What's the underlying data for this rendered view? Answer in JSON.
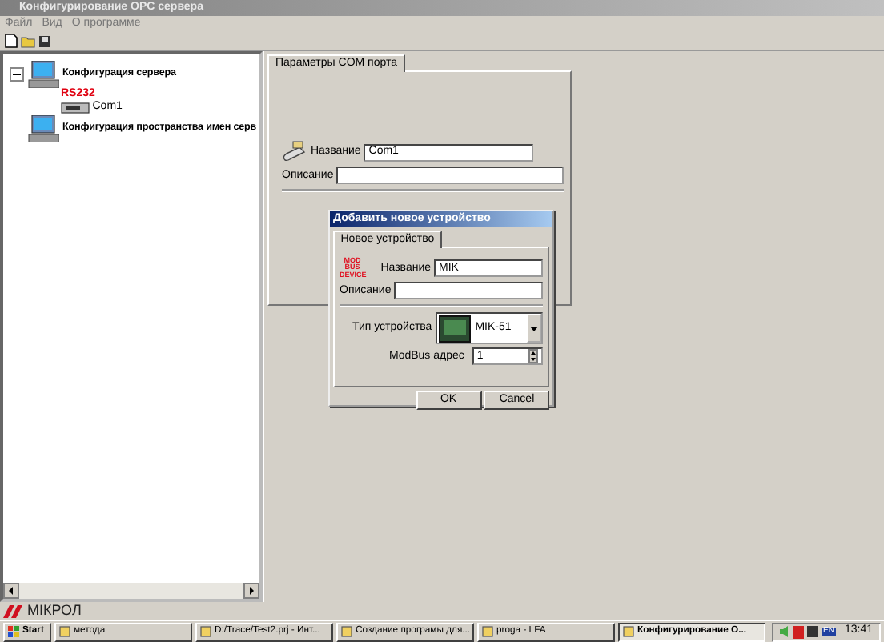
{
  "window": {
    "title": "Конфигурирование OPC сервера"
  },
  "menu": [
    {
      "label": "Файл"
    },
    {
      "label": "Вид"
    },
    {
      "label": "О программе"
    }
  ],
  "tree": [
    {
      "label": "Конфигурация сервера",
      "expanded": true,
      "children": [
        {
          "label": "RS232",
          "caption": "Com1"
        }
      ]
    },
    {
      "label": "Конфигурация пространства имен серв"
    }
  ],
  "port_panel": {
    "tabs": [
      {
        "label": "Параметры COM порта",
        "selected": true
      }
    ],
    "name_label": "Название",
    "name_value": "Com1",
    "description_label": "Описание"
  },
  "dialog": {
    "title": "Добавить новое устройство",
    "tabs": [
      {
        "label": "Новое устройство",
        "selected": true
      }
    ],
    "logo_lines": [
      "MOD",
      "BUS",
      "DEVICE"
    ],
    "name_label": "Название",
    "name_value": "MIK",
    "description_label": "Описание",
    "device_type_label": "Тип устройства",
    "device_type_value": "MIK-51",
    "modbus_label": "ModBus адрес",
    "modbus_value": "1",
    "buttons": [
      "OK",
      "Cancel"
    ]
  },
  "brand": "МІКРОЛ",
  "taskbar": {
    "start": "Start",
    "tasks": [
      {
        "label": "метода",
        "active": false
      },
      {
        "label": "D:/Trace/Test2.prj - Инт...",
        "active": false
      },
      {
        "label": "Создание програмы для...",
        "active": false
      },
      {
        "label": "proga - LFA",
        "active": false
      },
      {
        "label": "Конфигурирование О...",
        "active": true
      }
    ],
    "lang": "EN",
    "clock": "13:41"
  }
}
